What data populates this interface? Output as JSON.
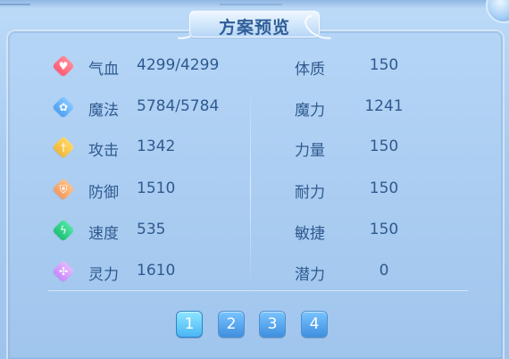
{
  "title": "方案预览",
  "colors": {
    "qixue": "#ff6f82",
    "mofa": "#68b6ff",
    "gongji": "#f4c74a",
    "fangyu": "#f5ad72",
    "sudu": "#31d28a",
    "lingli": "#d59cff"
  },
  "stats_left": [
    {
      "label": "气血",
      "value": "4299/4299",
      "icon": "heart-icon"
    },
    {
      "label": "魔法",
      "value": "5784/5784",
      "icon": "mana-icon"
    },
    {
      "label": "攻击",
      "value": "1342",
      "icon": "sword-icon"
    },
    {
      "label": "防御",
      "value": "1510",
      "icon": "shield-icon"
    },
    {
      "label": "速度",
      "value": "535",
      "icon": "bolt-icon"
    },
    {
      "label": "灵力",
      "value": "1610",
      "icon": "spirit-icon"
    }
  ],
  "stats_right": [
    {
      "label": "体质",
      "value": "150"
    },
    {
      "label": "魔力",
      "value": "1241"
    },
    {
      "label": "力量",
      "value": "150"
    },
    {
      "label": "耐力",
      "value": "150"
    },
    {
      "label": "敏捷",
      "value": "150"
    },
    {
      "label": "潜力",
      "value": "0"
    }
  ],
  "pages": [
    "1",
    "2",
    "3",
    "4"
  ],
  "current_page": "1"
}
